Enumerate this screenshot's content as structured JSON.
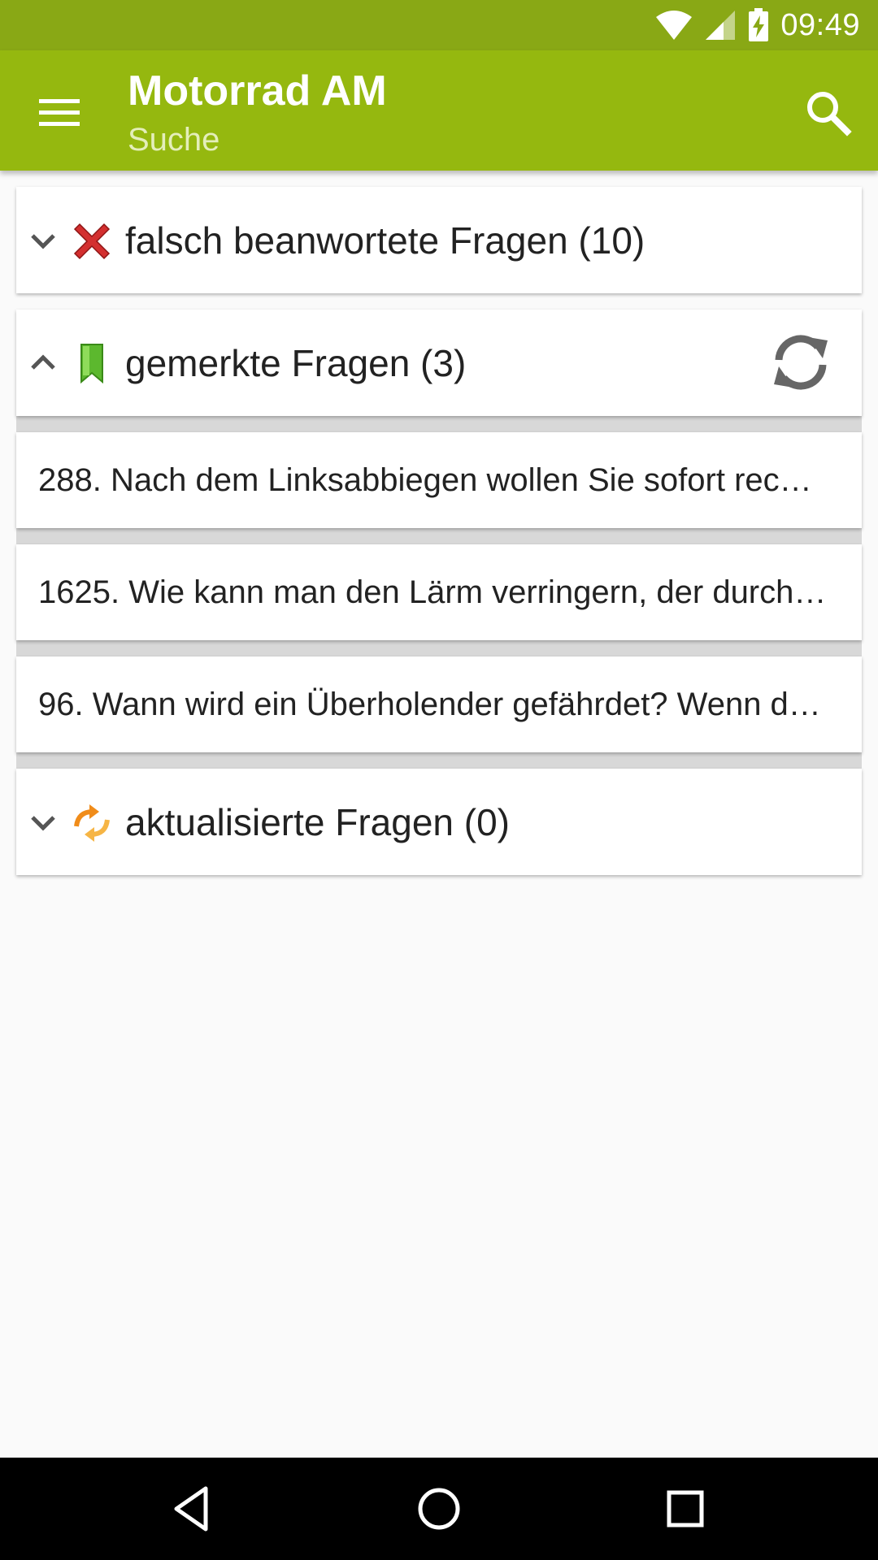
{
  "status_bar": {
    "time": "09:49",
    "icons": [
      "wifi-icon",
      "cell-signal-icon",
      "battery-charging-icon"
    ]
  },
  "app_bar": {
    "title": "Motorrad AM",
    "subtitle": "Suche",
    "icons": [
      "menu-icon",
      "search-icon"
    ]
  },
  "groups": [
    {
      "label": "falsch beanwortete Fragen (10)",
      "icon": "red-x-icon",
      "expanded": false
    },
    {
      "label": "gemerkte Fragen (3)",
      "icon": "green-bookmark-icon",
      "expanded": true,
      "action_icon": "refresh-icon",
      "items": [
        {
          "label": "288. Nach dem Linksabbiegen wollen Sie sofort rec…"
        },
        {
          "label": "1625. Wie kann man den Lärm verringern, der durch…"
        },
        {
          "label": "96. Wann wird ein Überholender gefährdet? Wenn d…"
        }
      ]
    },
    {
      "label": "aktualisierte Fragen (0)",
      "icon": "orange-update-arrows-icon",
      "expanded": false
    }
  ],
  "nav_bar": {
    "icons": [
      "back-icon",
      "home-icon",
      "recents-icon"
    ]
  },
  "colors": {
    "status_bar": "#89a815",
    "app_bar": "#95b80f",
    "subtitle": "#e4eeba",
    "background": "#fafafa",
    "error_red": "#d32f2f",
    "bookmark_green": "#5cb82e",
    "update_orange": "#f08c1a"
  }
}
